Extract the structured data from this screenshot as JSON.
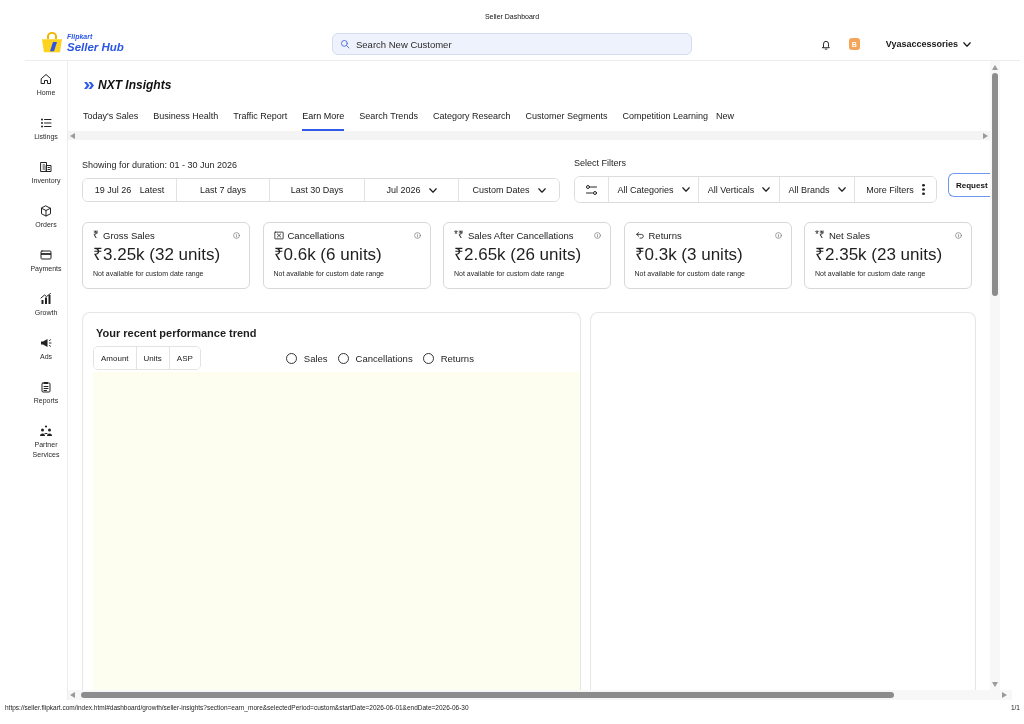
{
  "print_header": {
    "title": "Seller Dashboard"
  },
  "topbar": {
    "logo": {
      "brand": "Flipkart",
      "product": "Seller Hub"
    },
    "search": {
      "placeholder": "Search New Customer"
    },
    "avatar": "B",
    "account": "Vyasaccessories"
  },
  "sidebar": {
    "items": [
      {
        "label": "Home",
        "selected": false
      },
      {
        "label": "Listings",
        "selected": false
      },
      {
        "label": "Inventory",
        "selected": false
      },
      {
        "label": "Orders",
        "selected": false
      },
      {
        "label": "Payments",
        "selected": false
      },
      {
        "label": "Growth",
        "selected": false
      },
      {
        "label": "Ads",
        "selected": false
      },
      {
        "label": "Reports",
        "selected": false
      },
      {
        "label": "Partner Services",
        "selected": false
      }
    ]
  },
  "insights": {
    "title": "NXT Insights",
    "tabs": [
      {
        "label": "Today's Sales",
        "selected": false
      },
      {
        "label": "Business Health",
        "selected": false
      },
      {
        "label": "Traffic Report",
        "selected": false
      },
      {
        "label": "Earn More",
        "selected": true
      },
      {
        "label": "Search Trends",
        "selected": false
      },
      {
        "label": "Category Research",
        "selected": false
      },
      {
        "label": "Customer Segments",
        "selected": false
      },
      {
        "label": "Competition Learning",
        "selected": false,
        "badge": "New"
      }
    ],
    "duration": {
      "label": "Showing for duration: 01 - 30 Jun 2026",
      "options": [
        {
          "label": "19 Jul 26",
          "note": "Latest",
          "kind": "button",
          "selected": false
        },
        {
          "label": "Last 7 days",
          "kind": "button",
          "selected": false
        },
        {
          "label": "Last 30 Days",
          "kind": "button",
          "selected": false
        },
        {
          "label": "Jul 2026",
          "kind": "dropdown",
          "selected": false
        },
        {
          "label": "Custom Dates",
          "kind": "dropdown",
          "selected": false
        }
      ]
    },
    "filters": {
      "label": "Select Filters",
      "items": [
        {
          "label": "All Categories",
          "kind": "dropdown"
        },
        {
          "label": "All Verticals",
          "kind": "dropdown"
        },
        {
          "label": "All Brands",
          "kind": "dropdown"
        },
        {
          "label": "More Filters",
          "kind": "menu"
        }
      ]
    },
    "request_button": "Request",
    "cards": [
      {
        "symbol": "₹",
        "title": "Gross Sales",
        "value": "₹3.25k (32 units)",
        "note": "Not available for custom date range"
      },
      {
        "title": "Cancellations",
        "value": "₹0.6k (6 units)",
        "note": "Not available for custom date range"
      },
      {
        "symbol": "*₹",
        "title": "Sales After Cancellations",
        "value": "₹2.65k (26 units)",
        "note": "Not available for custom date range"
      },
      {
        "title": "Returns",
        "value": "₹0.3k (3 units)",
        "note": "Not available for custom date range"
      },
      {
        "symbol": "*₹",
        "title": "Net Sales",
        "value": "₹2.35k (23 units)",
        "note": "Not available for custom date range"
      }
    ],
    "trend": {
      "title": "Your recent performance trend",
      "measures": [
        {
          "label": "Amount",
          "selected": false
        },
        {
          "label": "Units",
          "selected": false
        },
        {
          "label": "ASP",
          "selected": false
        }
      ],
      "series": [
        {
          "label": "Sales",
          "checked": false
        },
        {
          "label": "Cancellations",
          "checked": false
        },
        {
          "label": "Returns",
          "checked": false
        }
      ]
    }
  },
  "footer": {
    "url": "https://seller.flipkart.com/index.html#dashboard/growth/seller-insights?section=earn_more&selectedPeriod=custom&startDate=2026-06-01&endDate=2026-06-30",
    "page": "1/1"
  }
}
